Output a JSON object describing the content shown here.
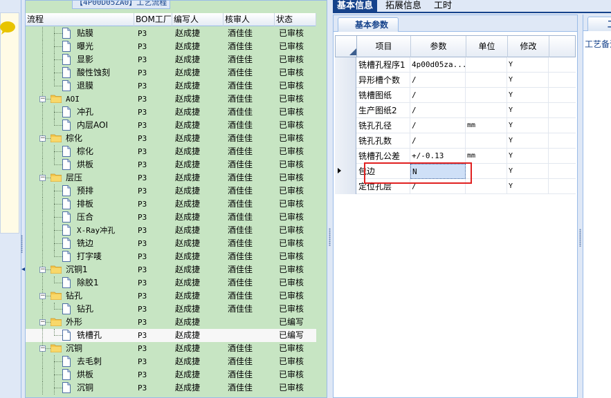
{
  "tree_panel": {
    "title": "【4P00D05ZA0】工艺流程",
    "columns": {
      "flow": "流程",
      "bom_factory": "BOM工厂",
      "writer": "编写人",
      "reviewer": "核审人",
      "status": "状态"
    },
    "rows": [
      {
        "label": "贴膜",
        "kind": "doc",
        "depth": 1,
        "factory": "P3",
        "writer": "赵成捷",
        "reviewer": "酒佳佳",
        "status": "已审核"
      },
      {
        "label": "曝光",
        "kind": "doc",
        "depth": 1,
        "factory": "P3",
        "writer": "赵成捷",
        "reviewer": "酒佳佳",
        "status": "已审核"
      },
      {
        "label": "显影",
        "kind": "doc",
        "depth": 1,
        "factory": "P3",
        "writer": "赵成捷",
        "reviewer": "酒佳佳",
        "status": "已审核"
      },
      {
        "label": "酸性蚀刻",
        "kind": "doc",
        "depth": 1,
        "factory": "P3",
        "writer": "赵成捷",
        "reviewer": "酒佳佳",
        "status": "已审核"
      },
      {
        "label": "退膜",
        "kind": "doc",
        "depth": 1,
        "last": true,
        "factory": "P3",
        "writer": "赵成捷",
        "reviewer": "酒佳佳",
        "status": "已审核"
      },
      {
        "label": "AOI",
        "kind": "folder",
        "depth": 0,
        "factory": "P3",
        "writer": "赵成捷",
        "reviewer": "酒佳佳",
        "status": "已审核"
      },
      {
        "label": "冲孔",
        "kind": "doc",
        "depth": 1,
        "factory": "P3",
        "writer": "赵成捷",
        "reviewer": "酒佳佳",
        "status": "已审核"
      },
      {
        "label": "内层AOI",
        "kind": "doc",
        "depth": 1,
        "last": true,
        "factory": "P3",
        "writer": "赵成捷",
        "reviewer": "酒佳佳",
        "status": "已审核"
      },
      {
        "label": "棕化",
        "kind": "folder",
        "depth": 0,
        "factory": "P3",
        "writer": "赵成捷",
        "reviewer": "酒佳佳",
        "status": "已审核"
      },
      {
        "label": "棕化",
        "kind": "doc",
        "depth": 1,
        "factory": "P3",
        "writer": "赵成捷",
        "reviewer": "酒佳佳",
        "status": "已审核"
      },
      {
        "label": "烘板",
        "kind": "doc",
        "depth": 1,
        "last": true,
        "factory": "P3",
        "writer": "赵成捷",
        "reviewer": "酒佳佳",
        "status": "已审核"
      },
      {
        "label": "层压",
        "kind": "folder",
        "depth": 0,
        "factory": "P3",
        "writer": "赵成捷",
        "reviewer": "酒佳佳",
        "status": "已审核"
      },
      {
        "label": "预排",
        "kind": "doc",
        "depth": 1,
        "factory": "P3",
        "writer": "赵成捷",
        "reviewer": "酒佳佳",
        "status": "已审核"
      },
      {
        "label": "排板",
        "kind": "doc",
        "depth": 1,
        "factory": "P3",
        "writer": "赵成捷",
        "reviewer": "酒佳佳",
        "status": "已审核"
      },
      {
        "label": "压合",
        "kind": "doc",
        "depth": 1,
        "factory": "P3",
        "writer": "赵成捷",
        "reviewer": "酒佳佳",
        "status": "已审核"
      },
      {
        "label": "X-Ray冲孔",
        "kind": "doc",
        "depth": 1,
        "factory": "P3",
        "writer": "赵成捷",
        "reviewer": "酒佳佳",
        "status": "已审核"
      },
      {
        "label": "铣边",
        "kind": "doc",
        "depth": 1,
        "factory": "P3",
        "writer": "赵成捷",
        "reviewer": "酒佳佳",
        "status": "已审核"
      },
      {
        "label": "打字唛",
        "kind": "doc",
        "depth": 1,
        "last": true,
        "factory": "P3",
        "writer": "赵成捷",
        "reviewer": "酒佳佳",
        "status": "已审核"
      },
      {
        "label": "沉铜1",
        "kind": "folder",
        "depth": 0,
        "factory": "P3",
        "writer": "赵成捷",
        "reviewer": "酒佳佳",
        "status": "已审核"
      },
      {
        "label": "除胶1",
        "kind": "doc",
        "depth": 1,
        "last": true,
        "factory": "P3",
        "writer": "赵成捷",
        "reviewer": "酒佳佳",
        "status": "已审核"
      },
      {
        "label": "钻孔",
        "kind": "folder",
        "depth": 0,
        "factory": "P3",
        "writer": "赵成捷",
        "reviewer": "酒佳佳",
        "status": "已审核"
      },
      {
        "label": "钻孔",
        "kind": "doc",
        "depth": 1,
        "last": true,
        "factory": "P3",
        "writer": "赵成捷",
        "reviewer": "酒佳佳",
        "status": "已审核"
      },
      {
        "label": "外形",
        "kind": "folder",
        "depth": 0,
        "factory": "P3",
        "writer": "赵成捷",
        "reviewer": "",
        "status": "已编写"
      },
      {
        "label": "铣槽孔",
        "kind": "doc",
        "depth": 1,
        "last": true,
        "selected": true,
        "factory": "P3",
        "writer": "赵成捷",
        "reviewer": "",
        "status": "已编写"
      },
      {
        "label": "沉铜",
        "kind": "folder",
        "depth": 0,
        "factory": "P3",
        "writer": "赵成捷",
        "reviewer": "酒佳佳",
        "status": "已审核"
      },
      {
        "label": "去毛刺",
        "kind": "doc",
        "depth": 1,
        "factory": "P3",
        "writer": "赵成捷",
        "reviewer": "酒佳佳",
        "status": "已审核"
      },
      {
        "label": "烘板",
        "kind": "doc",
        "depth": 1,
        "factory": "P3",
        "writer": "赵成捷",
        "reviewer": "酒佳佳",
        "status": "已审核"
      },
      {
        "label": "沉铜",
        "kind": "doc",
        "depth": 1,
        "factory": "P3",
        "writer": "赵成捷",
        "reviewer": "酒佳佳",
        "status": "已审核"
      }
    ]
  },
  "top_tabs": [
    "基本信息",
    "拓展信息",
    "工时"
  ],
  "detail": {
    "tab_label": "基本参数",
    "columns": {
      "item": "项目",
      "param": "参数",
      "unit": "单位",
      "modify": "修改"
    },
    "rows": [
      {
        "item": "铣槽孔程序1",
        "param": "4p00d05za...",
        "unit": "",
        "modify": "Y"
      },
      {
        "item": "异形槽个数",
        "param": "/",
        "unit": "",
        "modify": "Y"
      },
      {
        "item": "铣槽图纸",
        "param": "/",
        "unit": "",
        "modify": "Y"
      },
      {
        "item": "生产图纸2",
        "param": "/",
        "unit": "",
        "modify": "Y"
      },
      {
        "item": "铣孔孔径",
        "param": "/",
        "unit": "mm",
        "modify": "Y"
      },
      {
        "item": "铣孔孔数",
        "param": "/",
        "unit": "",
        "modify": "Y"
      },
      {
        "item": "铣槽孔公差",
        "param": "+/-0.13",
        "unit": "mm",
        "modify": "Y"
      },
      {
        "item": "包边",
        "param": "N",
        "unit": "",
        "modify": "Y",
        "current": true
      },
      {
        "item": "定位孔层",
        "param": "/",
        "unit": "",
        "modify": "Y"
      }
    ]
  },
  "side_panel": {
    "tab_label": "工",
    "label": "工艺备注"
  },
  "colors": {
    "tree_bg": "#c7e5c3",
    "accent": "#15428b",
    "highlight_border": "#e02020"
  },
  "icons": [
    "chat-bubble-icon",
    "folder-icon",
    "document-icon",
    "collapse-toggle-icon",
    "row-pointer-icon"
  ]
}
